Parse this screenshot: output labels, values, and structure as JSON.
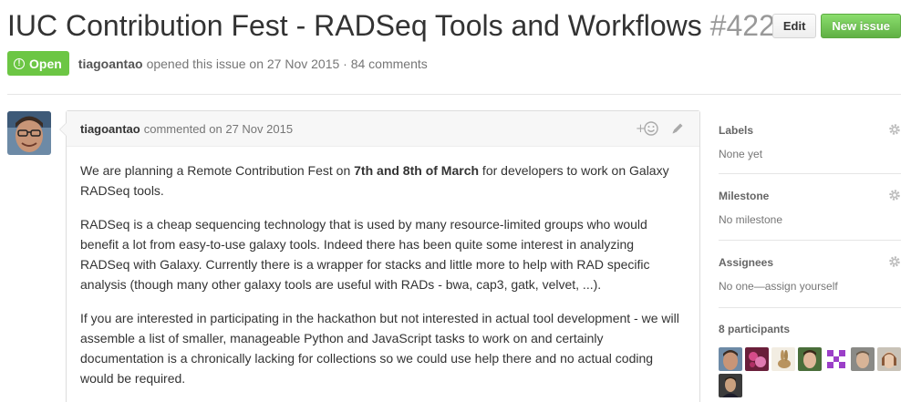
{
  "issue": {
    "title": "IUC Contribution Fest - RADSeq Tools and Workflows",
    "number": "#422",
    "state": "Open",
    "author": "tiagoantao",
    "opened_text": "opened this issue on 27 Nov 2015 · 84 comments"
  },
  "header_actions": {
    "edit_label": "Edit",
    "new_issue_label": "New issue"
  },
  "comment": {
    "author": "tiagoantao",
    "meta": "commented on 27 Nov 2015",
    "add_reaction_icon": "smiley-plus-icon",
    "edit_icon": "pencil-icon",
    "p1_pre": "We are planning a Remote Contribution Fest on ",
    "p1_bold": "7th and 8th of March",
    "p1_post": " for developers to work on Galaxy RADSeq tools.",
    "p2": "RADSeq is a cheap sequencing technology that is used by many resource-limited groups who would benefit a lot from easy-to-use galaxy tools. Indeed there has been quite some interest in analyzing RADSeq with Galaxy. Currently there is a wrapper for stacks and little more to help with RAD specific analysis (though many other galaxy tools are useful with RADs - bwa, cap3, gatk, velvet, ...).",
    "p3": "If you are interested in participating in the hackathon but not interested in actual tool development - we will assemble a list of smaller, manageable Python and JavaScript tasks to work on and certainly documentation is a chronically lacking for collections so we could use help there and no actual coding would be required."
  },
  "sidebar": {
    "labels_title": "Labels",
    "labels_value": "None yet",
    "milestone_title": "Milestone",
    "milestone_value": "No milestone",
    "assignees_title": "Assignees",
    "assignees_value": "No one—assign yourself",
    "participants_title": "8 participants"
  },
  "colors": {
    "open_green": "#6cc644",
    "new_issue_green": "#60b044",
    "muted": "#767676"
  }
}
